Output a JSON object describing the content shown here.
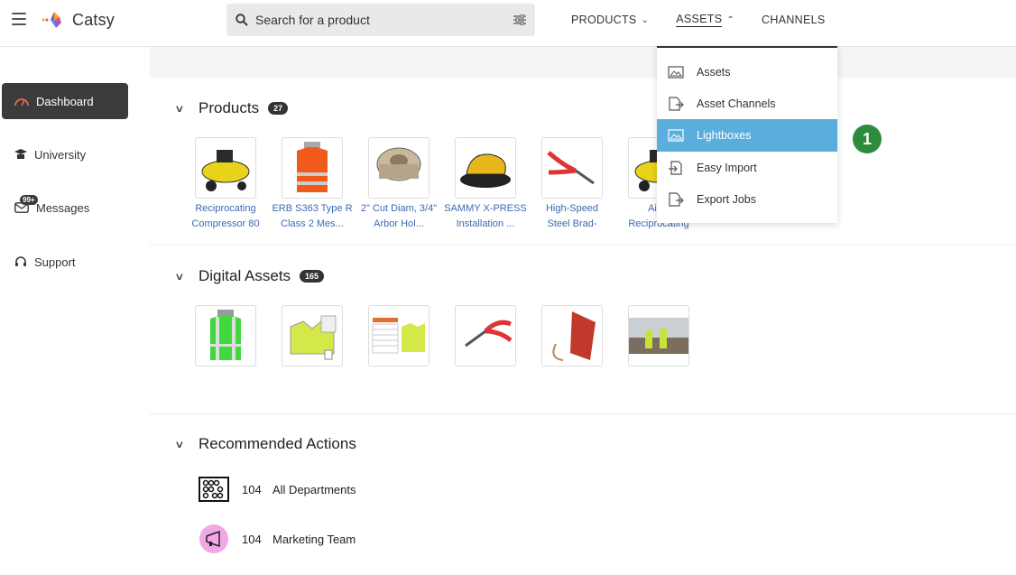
{
  "app": {
    "name": "Catsy"
  },
  "search": {
    "placeholder": "Search for a product"
  },
  "nav": {
    "products": "PRODUCTS",
    "assets": "ASSETS",
    "channels": "CHANNELS"
  },
  "sidebar": {
    "items": [
      {
        "label": "Dashboard",
        "icon": "dashboard-icon"
      },
      {
        "label": "University",
        "icon": "graduation-cap-icon"
      },
      {
        "label": "Messages",
        "icon": "envelope-icon",
        "badge": "99+"
      },
      {
        "label": "Support",
        "icon": "headset-icon"
      }
    ]
  },
  "products": {
    "title": "Products",
    "count": "27",
    "items": [
      {
        "line1": "Reciprocating",
        "line2": "Compressor 80"
      },
      {
        "line1": "ERB S363 Type R",
        "line2": "Class 2 Mes..."
      },
      {
        "line1": "2\" Cut Diam, 3/4\"",
        "line2": "Arbor Hol..."
      },
      {
        "line1": "SAMMY X-PRESS",
        "line2": "Installation ..."
      },
      {
        "line1": "High-Speed",
        "line2": "Steel Brad-"
      },
      {
        "line1": "AirSt",
        "line2": "Reciprocating"
      }
    ]
  },
  "digital_assets": {
    "title": "Digital Assets",
    "count": "165"
  },
  "recommended": {
    "title": "Recommended Actions",
    "items": [
      {
        "count": "104",
        "label": "All Departments",
        "icon": "abacus-icon"
      },
      {
        "count": "104",
        "label": "Marketing Team",
        "icon": "megaphone-icon"
      }
    ]
  },
  "assets_menu": {
    "items": [
      {
        "label": "Assets",
        "icon": "image-icon"
      },
      {
        "label": "Asset Channels",
        "icon": "file-export-icon"
      },
      {
        "label": "Lightboxes",
        "icon": "images-icon"
      },
      {
        "label": "Easy Import",
        "icon": "file-import-icon"
      },
      {
        "label": "Export Jobs",
        "icon": "file-export-icon"
      }
    ]
  },
  "step_marker": "1",
  "colors": {
    "active_menu": "#5aaedd",
    "step_marker": "#2e8b3e",
    "link": "#3d6ab0"
  }
}
